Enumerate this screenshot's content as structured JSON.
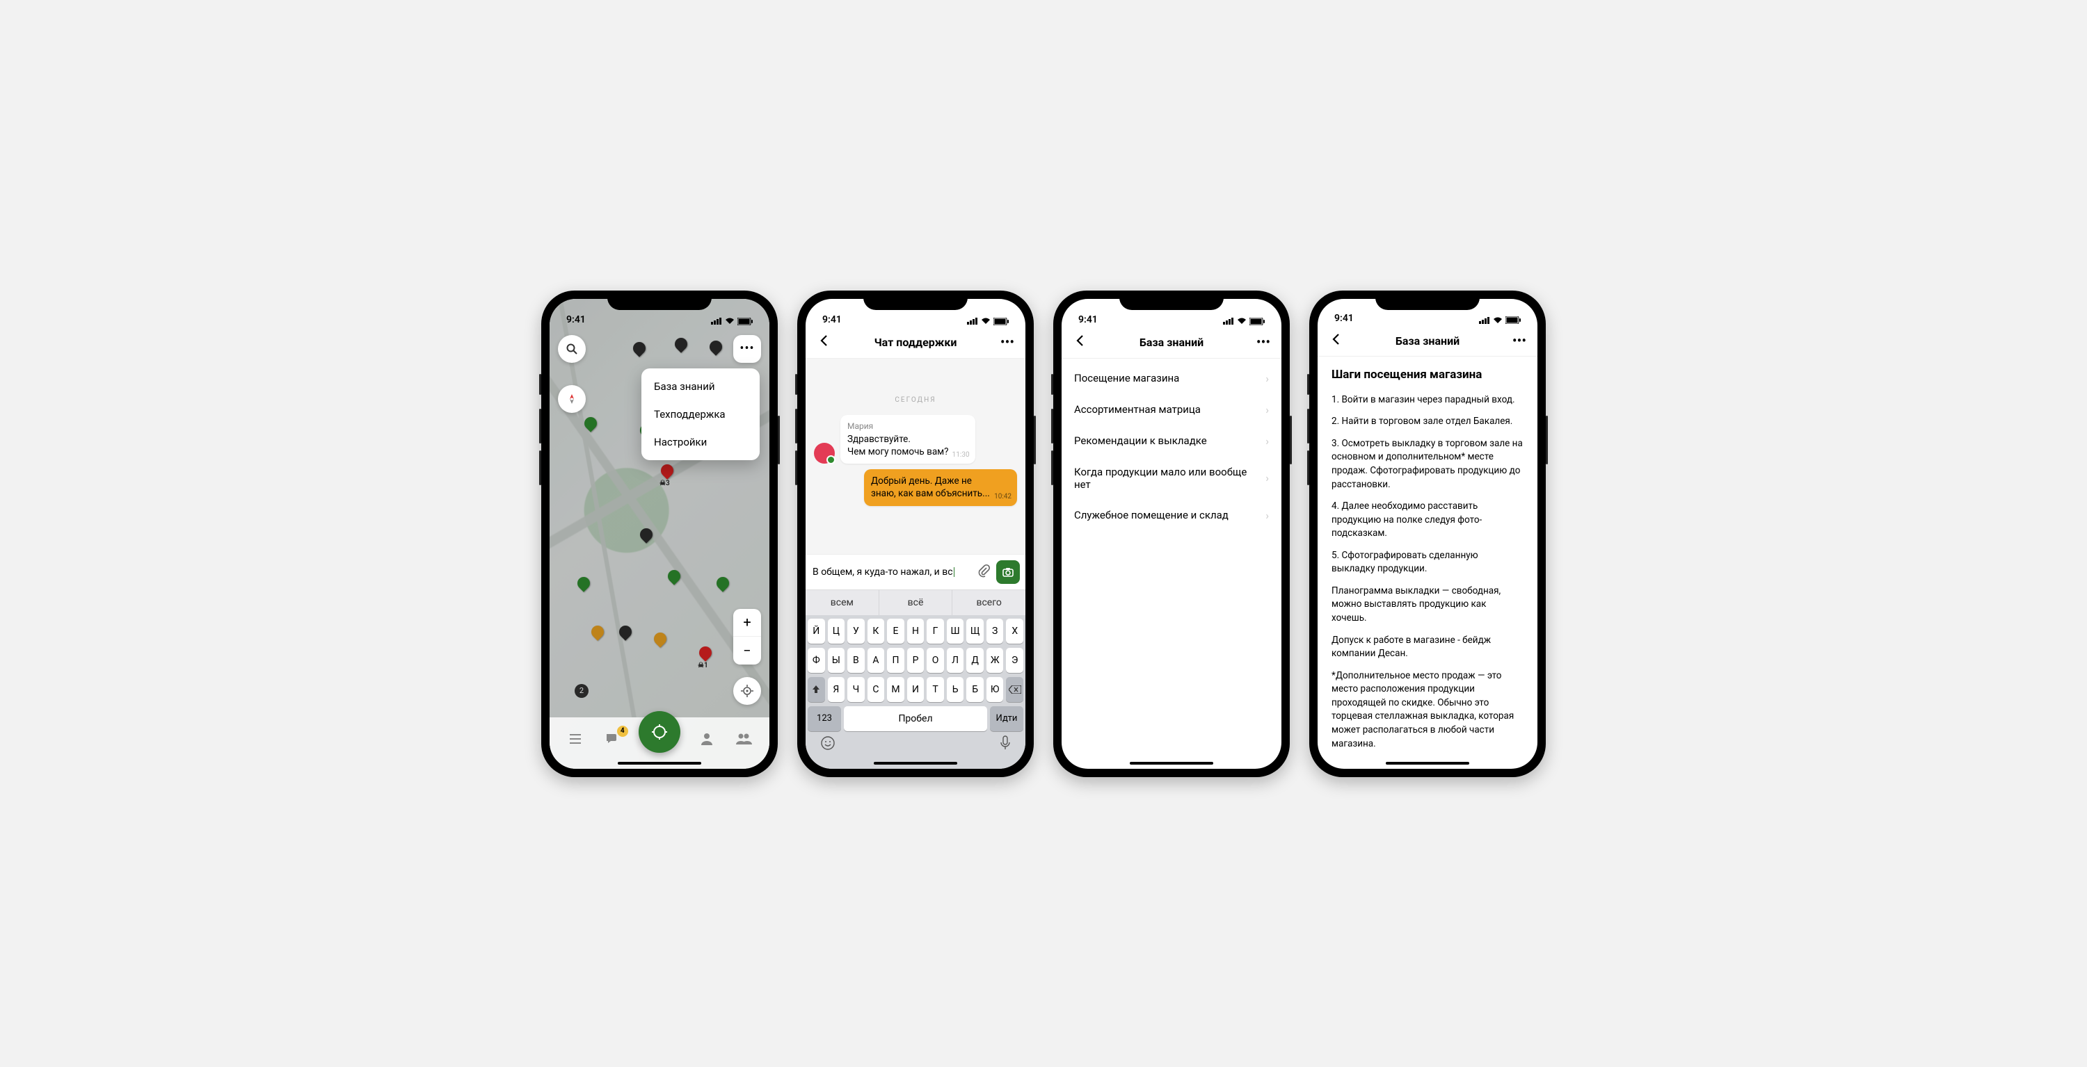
{
  "status": {
    "time": "9:41"
  },
  "screen1": {
    "menu": {
      "kb": "База знаний",
      "support": "Техподдержка",
      "settings": "Настройки"
    },
    "marker1": {
      "skull": "☠",
      "count": "3"
    },
    "marker2": {
      "skull": "☠",
      "count": "1"
    },
    "counter": "2",
    "zoom": {
      "in": "+",
      "out": "−"
    },
    "badge": "4"
  },
  "screen2": {
    "title": "Чат поддержки",
    "day": "СЕГОДНЯ",
    "msg_in": {
      "name": "Мария",
      "line1": "Здравствуйте.",
      "line2": "Чем могу помочь вам?",
      "time": "11:30"
    },
    "msg_out": {
      "text": "Добрый день. Даже не знаю, как вам объяснить...",
      "time": "10:42"
    },
    "input": "В общем, я куда-то нажал, и вс",
    "sugg": {
      "a": "всем",
      "b": "всё",
      "c": "всего"
    },
    "kb_rows": {
      "r1": [
        "Й",
        "Ц",
        "У",
        "К",
        "Е",
        "Н",
        "Г",
        "Ш",
        "Щ",
        "З",
        "Х"
      ],
      "r2": [
        "Ф",
        "Ы",
        "В",
        "А",
        "П",
        "Р",
        "О",
        "Л",
        "Д",
        "Ж",
        "Э"
      ],
      "r3": [
        "Я",
        "Ч",
        "С",
        "М",
        "И",
        "Т",
        "Ь",
        "Б",
        "Ю"
      ]
    },
    "kb_fn": {
      "num": "123",
      "space": "Пробел",
      "go": "Идти"
    }
  },
  "screen3": {
    "title": "База знаний",
    "items": [
      "Посещение магазина",
      "Ассортиментная матрица",
      "Рекомендации к выкладке",
      "Когда продукции мало или вообще нет",
      "Служебное помещение и склад"
    ]
  },
  "screen4": {
    "title": "База знаний",
    "heading": "Шаги посещения магазина",
    "p1": "1. Войти в магазин через парадный вход.",
    "p2": "2. Найти в торговом зале отдел Бакалея.",
    "p3": "3. Осмотреть выкладку в торговом зале на основном и дополнительном* месте продаж. Сфотографировать продукцию до расстановки.",
    "p4": "4. Далее необходимо расставить продукцию на полке следуя фото-подсказкам.",
    "p5": "5. Сфотографировать сделанную выкладку продукции.",
    "p6": "Планограмма выкладки — свободная, можно выставлять продукцию как хочешь.",
    "p7": "Допуск к работе в магазине - бейдж компании Десан.",
    "p8": "*Дополнительное место продаж — это место расположения продукции проходящей по скидке. Обычно это торцевая стеллажная выкладка, которая может располагаться в любой части магазина."
  }
}
